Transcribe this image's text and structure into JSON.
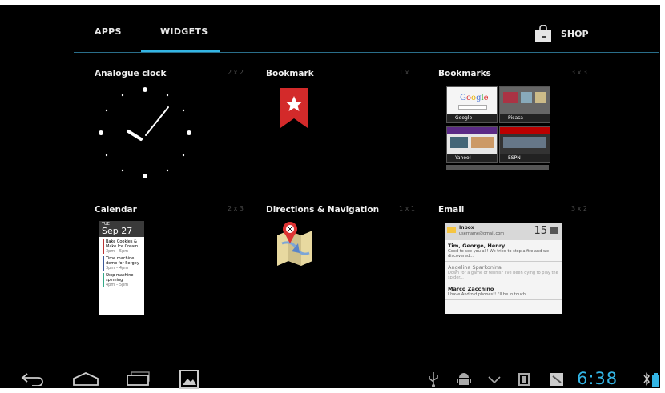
{
  "tabs": {
    "apps": "APPS",
    "widgets": "WIDGETS",
    "shop": "SHOP",
    "active": "widgets"
  },
  "widgets": [
    {
      "title": "Analogue clock",
      "dims": "2 x 2"
    },
    {
      "title": "Bookmark",
      "dims": "1 x 1"
    },
    {
      "title": "Bookmarks",
      "dims": "3 x 3"
    },
    {
      "title": "Calendar",
      "dims": "2 x 3"
    },
    {
      "title": "Directions & Navigation",
      "dims": "1 x 1"
    },
    {
      "title": "Email",
      "dims": "3 x 2"
    }
  ],
  "bookmarks_preview": [
    "Google",
    "Picasa",
    "Yahoo!",
    "ESPN"
  ],
  "calendar_preview": {
    "dow": "TUE",
    "date": "Sep 27",
    "events": [
      {
        "title": "Bake Cookies & Make Ice Cream",
        "meta": "3pm – 5pm"
      },
      {
        "title": "Time machine demo for Sergey",
        "meta": "3pm – 4pm"
      },
      {
        "title": "Stop machine spinning",
        "meta": "4pm – 5pm"
      }
    ]
  },
  "email_preview": {
    "folder": "Inbox",
    "account": "username@gmail.com",
    "count": "15",
    "messages": [
      {
        "from": "Tim, George, Henry",
        "body": "Good to see you all! We tried to stop a fire and we discovered..."
      },
      {
        "from": "Angelina Sparkonina",
        "body": "Down for a game of tennis? I've been dying to play the spider..."
      },
      {
        "from": "Marco Zacchino",
        "body": "I have Android phones!! I'll be in touch..."
      }
    ]
  },
  "status": {
    "time": "6:38"
  },
  "colors": {
    "accent": "#33b5e5",
    "background": "#000000"
  }
}
